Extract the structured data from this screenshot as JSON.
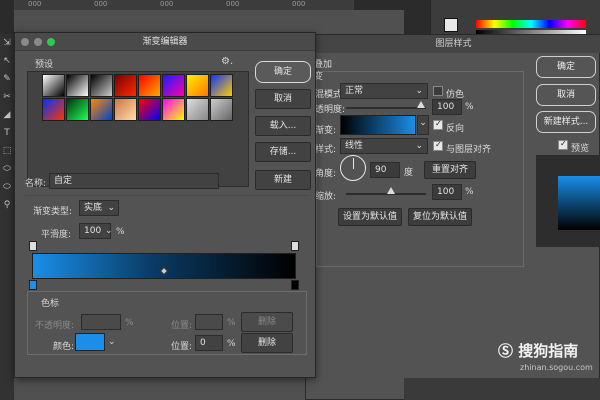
{
  "ruler": {
    "ticks": [
      "000",
      "000",
      "000",
      "000",
      "000"
    ]
  },
  "left_tools": [
    "⇲",
    "↖",
    "✎",
    "✂",
    "◢",
    "T",
    "⬚",
    "⬭",
    "⬭",
    "⚲"
  ],
  "layer_style": {
    "title": "图层样式",
    "section_title": "叠加",
    "section_sub": "变",
    "blend_mode_label": "混模式:",
    "blend_mode_value": "正常",
    "dither_label": "仿色",
    "opacity_label": "透明度:",
    "opacity_value": "100",
    "opacity_unit": "%",
    "gradient_label": "渐变:",
    "reverse_label": "反向",
    "style_label": "样式:",
    "style_value": "线性",
    "align_label": "与图层对齐",
    "angle_label": "角度:",
    "angle_value": "90",
    "angle_unit": "度",
    "reset_align_label": "重置对齐",
    "scale_label": "缩放:",
    "scale_value": "100",
    "scale_unit": "%",
    "set_default_label": "设置为默认值",
    "reset_default_label": "复位为默认值",
    "ok_label": "确定",
    "cancel_label": "取消",
    "new_style_label": "新建样式...",
    "preview_label": "预览"
  },
  "gradient_editor": {
    "title": "渐变编辑器",
    "presets_label": "预设",
    "settings_icon": "gear-icon",
    "preset_colors": [
      [
        "#ffffff",
        "#000000"
      ],
      [
        "#000000",
        "#ffffff"
      ],
      [
        "#000000",
        "#cccccc"
      ],
      [
        "#7a0000",
        "#ff2a00"
      ],
      [
        "#ff0000",
        "#ffaa00"
      ],
      [
        "#1a1aff",
        "#ff00aa"
      ],
      [
        "#ffee00",
        "#ff7700"
      ],
      [
        "#1133ff",
        "#ffcc00"
      ],
      [
        "#0033ff",
        "#ff3300"
      ],
      [
        "#003311",
        "#22ff55"
      ],
      [
        "#ff8800",
        "#0044cc"
      ],
      [
        "#cc7744",
        "#ffddaa"
      ],
      [
        "#ff0000",
        "#0000ff"
      ],
      [
        "#ff00ff",
        "#ffff00"
      ],
      [
        "#dddddd",
        "#888888"
      ],
      [
        "#cccccc",
        "#666666"
      ]
    ],
    "ok_label": "确定",
    "cancel_label": "取消",
    "load_label": "载入...",
    "save_label": "存储...",
    "name_label": "名称:",
    "name_value": "自定",
    "new_label": "新建",
    "type_label": "渐变类型:",
    "type_value": "实底",
    "smoothness_label": "平滑度:",
    "smoothness_value": "100",
    "smoothness_unit": "%",
    "color_stops_label": "色标",
    "opacity_label": "不透明度:",
    "opacity_unit": "%",
    "location_label": "位置:",
    "location_unit": "%",
    "delete_label": "删除",
    "color_label": "颜色:",
    "color_value": "#1a8ee8",
    "color_location_value": "0",
    "gradient_start": "#1a8ee8",
    "gradient_end": "#000000"
  },
  "watermark": {
    "text": "搜狗指南",
    "sub": "zhinan.sogou.com"
  }
}
